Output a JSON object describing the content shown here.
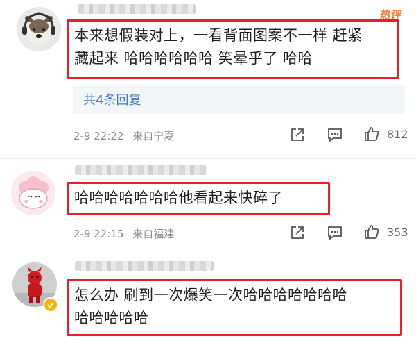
{
  "badge": {
    "hot_label": "热评"
  },
  "comments": [
    {
      "text_line1": "本来想假装对上，一看背面图案不一样 赶紧",
      "text_line2": "藏起来 哈哈哈哈哈哈 笑晕乎了 哈哈",
      "replies_label": "共4条回复",
      "time": "2-9 22:22",
      "location": "来自宁夏",
      "likes": "812"
    },
    {
      "text_line1": "哈哈哈哈哈哈哈他看起来快碎了",
      "time": "2-9 22:15",
      "location": "来自福建",
      "likes": "353"
    },
    {
      "text_line1": "怎么办 刷到一次爆笑一次哈哈哈哈哈哈哈",
      "text_line2": "哈哈哈哈哈"
    }
  ],
  "colors": {
    "highlight_border": "#e8202a",
    "reply_link": "#4a7ac0",
    "meta_text": "#8c8c8c",
    "verified_badge": "#f2b705"
  }
}
